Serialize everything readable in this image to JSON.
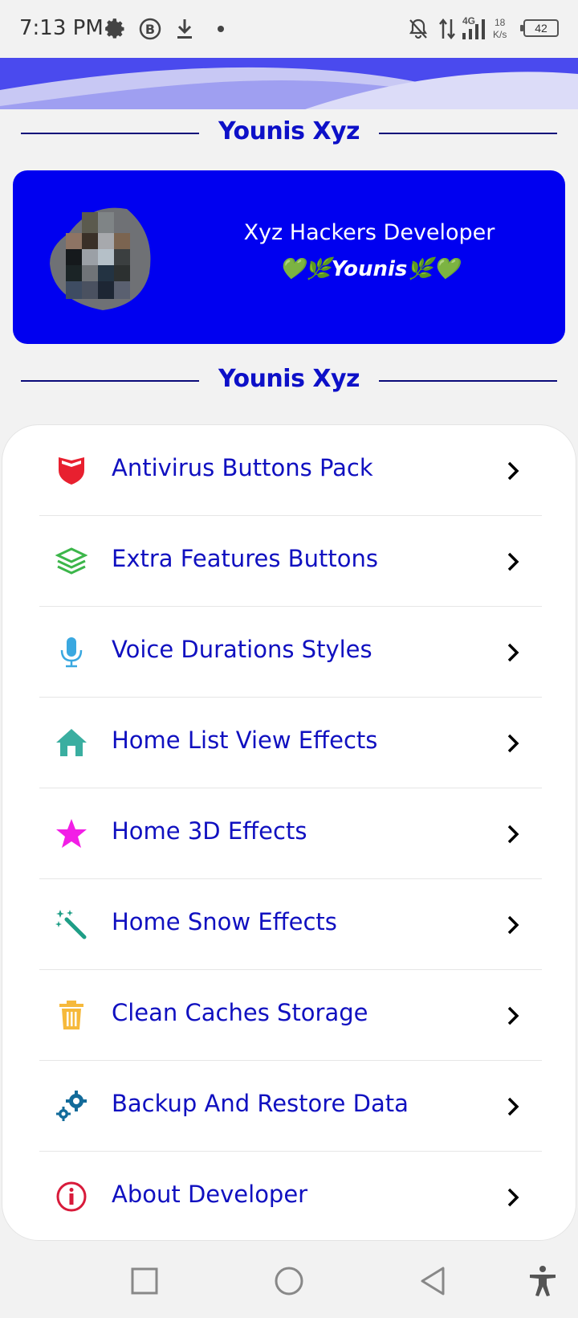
{
  "status_bar": {
    "time": "7:13 PM",
    "network_type": "4G",
    "speed_value": "18",
    "speed_unit": "K/s",
    "battery": "42",
    "icons": [
      "settings-icon",
      "business-b-icon",
      "download-icon",
      "dot-icon",
      "mute-icon",
      "data-arrows-icon",
      "signal-icon",
      "battery-icon"
    ]
  },
  "header": {
    "section_title_top": "Younis Xyz",
    "section_title_bottom": "Younis Xyz"
  },
  "profile": {
    "name": "Xyz Hackers Developer",
    "subtitle": "💚🌿Younis🌿💚"
  },
  "menu": {
    "items": [
      {
        "label": "Antivirus Buttons Pack",
        "icon": "shield-icon",
        "color": "#e8202f"
      },
      {
        "label": "Extra Features Buttons",
        "icon": "layers-icon",
        "color": "#3cb64a"
      },
      {
        "label": "Voice Durations Styles",
        "icon": "microphone-icon",
        "color": "#3aa8e0"
      },
      {
        "label": "Home List View Effects",
        "icon": "home-icon",
        "color": "#3aaea0"
      },
      {
        "label": "Home 3D Effects",
        "icon": "star-icon",
        "color": "#f21ee6"
      },
      {
        "label": "Home Snow Effects",
        "icon": "magic-wand-icon",
        "color": "#1e9e86"
      },
      {
        "label": "Clean Caches Storage",
        "icon": "trash-icon",
        "color": "#f6b93b"
      },
      {
        "label": "Backup And Restore Data",
        "icon": "gears-icon",
        "color": "#136b9a"
      },
      {
        "label": "About Developer",
        "icon": "info-icon",
        "color": "#d81a3a"
      }
    ]
  },
  "colors": {
    "accent": "#0000f0",
    "title_blue": "#0d10c8",
    "menu_text": "#1010c0"
  },
  "navbar": {
    "icons": [
      "recent-apps-icon",
      "home-circle-icon",
      "back-icon",
      "accessibility-icon"
    ]
  }
}
